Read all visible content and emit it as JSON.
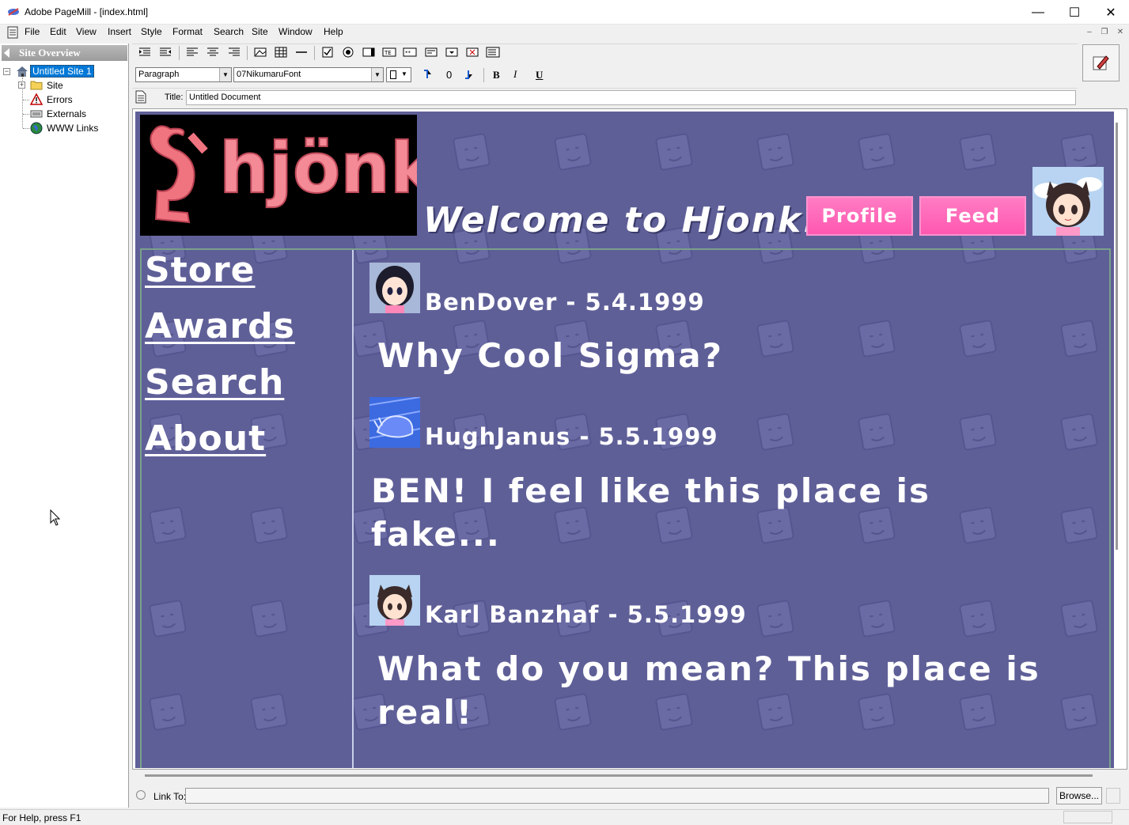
{
  "window": {
    "title": "Adobe PageMill - [index.html]",
    "minimize": "—",
    "maximize": "☐",
    "close": "✕"
  },
  "menu": [
    "File",
    "Edit",
    "View",
    "Insert",
    "Style",
    "Format",
    "Search",
    "Site",
    "Window",
    "Help"
  ],
  "site_panel": {
    "header": "Site Overview",
    "root": "Untitled Site 1",
    "items": [
      "Site",
      "Errors",
      "Externals",
      "WWW Links"
    ]
  },
  "toolbar": {
    "paragraph_style": "Paragraph",
    "font": "07NikumaruFont",
    "bold": "B",
    "italic": "I",
    "underline": "U",
    "title_label": "Title:",
    "title_value": "Untitled Document"
  },
  "page": {
    "logo_text": "hjönk",
    "welcome": "Welcome to Hjonk!",
    "buttons": [
      "Profile",
      "Feed"
    ],
    "nav": [
      "Store",
      "Awards",
      "Search",
      "About"
    ],
    "posts": [
      {
        "author": "BenDover",
        "date": "5.4.1999",
        "header": "BenDover - 5.4.1999",
        "body": "Why Cool Sigma?"
      },
      {
        "author": "HughJanus",
        "date": "5.5.1999",
        "header": "HughJanus - 5.5.1999",
        "body": "BEN! I feel like this place is fake..."
      },
      {
        "author": "Karl Banzhaf",
        "date": "5.5.1999",
        "header": "Karl Banzhaf - 5.5.1999",
        "body": "What do you mean? This place is real!"
      }
    ]
  },
  "link_bar": {
    "label": "Link To:",
    "value": "",
    "browse": "Browse..."
  },
  "status": {
    "text": "For Help, press F1"
  },
  "colors": {
    "page_background": "#5f5f98",
    "pink_button": "#ff64b6",
    "selection": "#0078d7"
  }
}
